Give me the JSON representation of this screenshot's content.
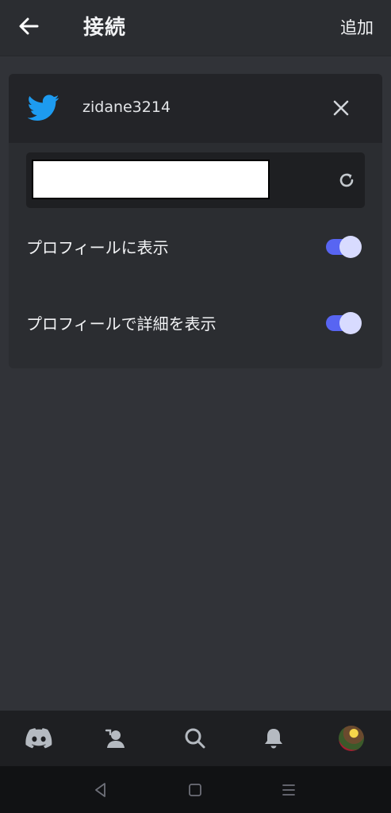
{
  "header": {
    "title": "接続",
    "add_label": "追加",
    "back_icon": "arrow-left-icon"
  },
  "connection": {
    "service_icon": "twitter-icon",
    "account_name": "zidane3214",
    "remove_icon": "close-icon",
    "refresh_icon": "refresh-icon",
    "toggles": [
      {
        "label": "プロフィールに表示",
        "on": true
      },
      {
        "label": "プロフィールで詳細を表示",
        "on": true
      }
    ]
  },
  "colors": {
    "background": "#313338",
    "card": "#2b2d31",
    "card_header": "#232428",
    "accent": "#5865f2",
    "twitter_blue": "#1d9bf0"
  },
  "bottom_nav": {
    "items": [
      "discord-home-icon",
      "friends-icon",
      "search-icon",
      "bell-icon",
      "avatar"
    ]
  },
  "system_nav": {
    "items": [
      "back-triangle-icon",
      "home-square-icon",
      "recents-menu-icon"
    ]
  }
}
